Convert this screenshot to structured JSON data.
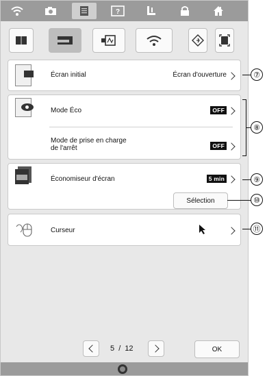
{
  "toolbar_icons": [
    "wifi-icon",
    "camera-icon",
    "document-icon",
    "help-icon",
    "sewing-foot-icon",
    "lock-icon",
    "home-icon"
  ],
  "tab_icons": [
    "book-icon",
    "sewing-machine-icon",
    "embroidery-frame-icon",
    "wifi-icon",
    "diamond-icon",
    "frame-icon"
  ],
  "settings": {
    "initial_screen": {
      "label": "Écran initial",
      "value": "Écran d'ouverture"
    },
    "eco_mode": {
      "label": "Mode Éco",
      "value": "OFF"
    },
    "shutdown_support": {
      "label_line1": "Mode de prise en charge",
      "label_line2": "de l'arrêt",
      "value": "OFF"
    },
    "screensaver": {
      "label": "Économiseur d'écran",
      "value": "5 min",
      "button": "Sélection"
    },
    "cursor": {
      "label": "Curseur"
    }
  },
  "pager": {
    "current": "5",
    "separator": "/",
    "total": "12",
    "ok_label": "OK"
  },
  "callouts": [
    "⑦",
    "⑧",
    "⑨",
    "⑩",
    "⑪"
  ]
}
